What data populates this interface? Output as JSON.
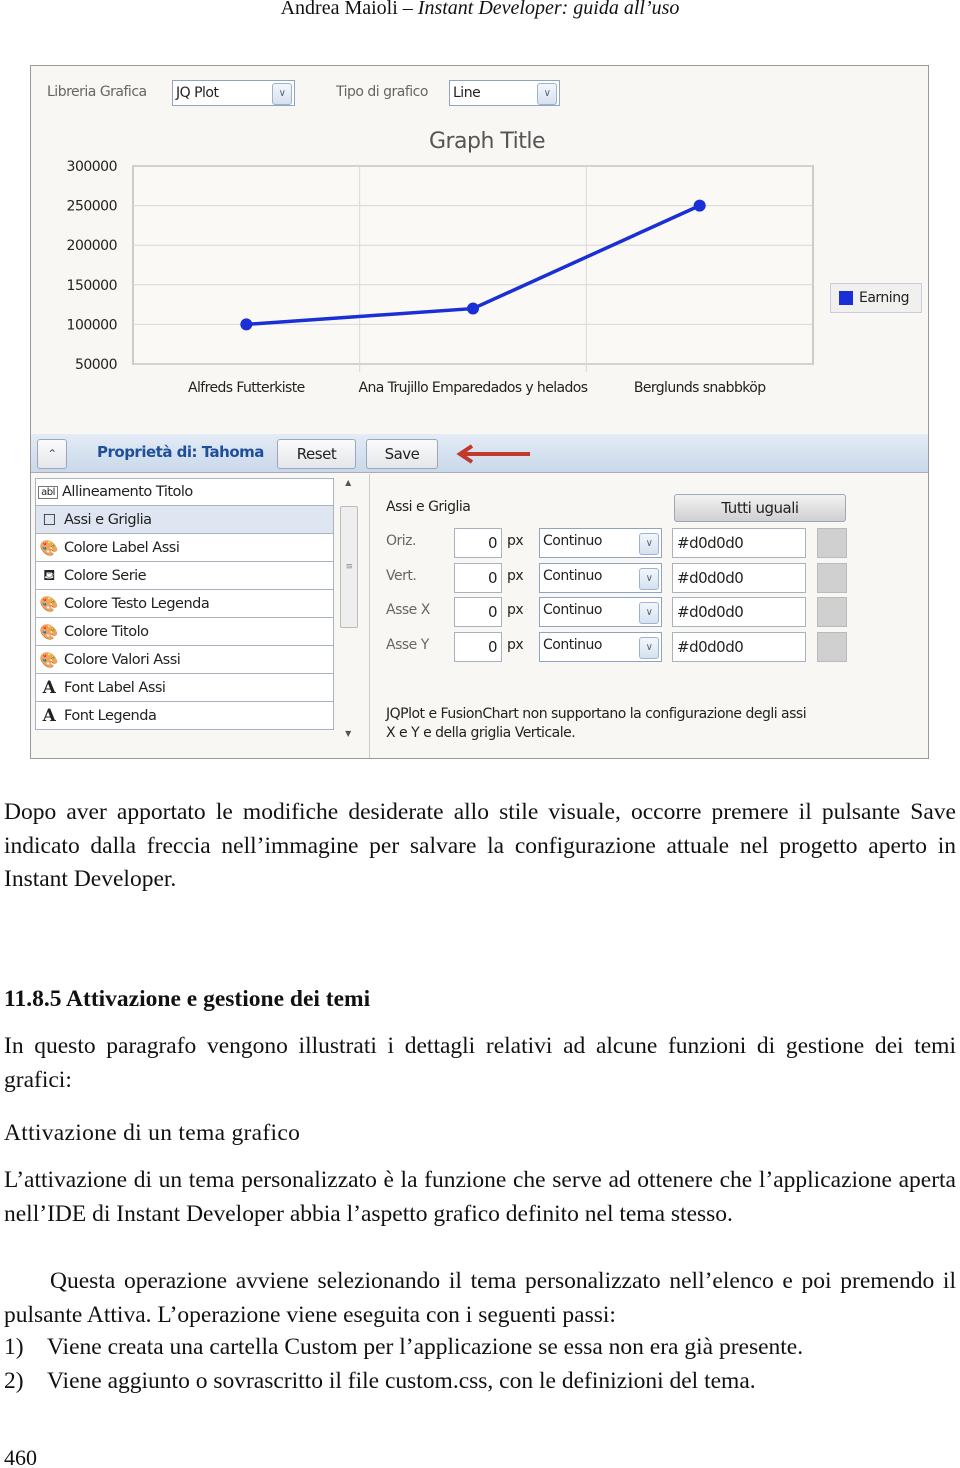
{
  "header": {
    "author": "Andrea Maioli",
    "separator": "–",
    "book": "Instant Developer: guida all’uso"
  },
  "screenshot": {
    "library_label": "Libreria Grafica",
    "library_value": "JQ Plot",
    "type_label": "Tipo di grafico",
    "type_value": "Line",
    "chart_data": {
      "type": "line",
      "title": "Graph Title",
      "categories": [
        "Alfreds Futterkiste",
        "Ana Trujillo Emparedados y helados",
        "Berglunds snabbköp"
      ],
      "series": [
        {
          "name": "Earning",
          "values": [
            100000,
            120000,
            250000
          ],
          "color": "#1a2fd6"
        }
      ],
      "yticks": [
        "300000",
        "250000",
        "200000",
        "150000",
        "100000",
        "50000"
      ],
      "ylim": [
        50000,
        300000
      ],
      "grid": true,
      "legend": "right"
    },
    "toolbar": {
      "title": "Proprietà di: Tahoma",
      "reset": "Reset",
      "save": "Save",
      "arrow_color": "#c0392b"
    },
    "list": [
      {
        "icon": "abl-text-icon",
        "glyph": "abl",
        "label": "Allineamento Titolo"
      },
      {
        "icon": "checkbox-icon",
        "glyph": "☐",
        "label": "Assi e Griglia",
        "selected": true
      },
      {
        "icon": "palette-icon",
        "glyph": "🎨",
        "label": "Colore Label Assi"
      },
      {
        "icon": "paint-bucket-icon",
        "glyph": "⛾",
        "label": "Colore Serie"
      },
      {
        "icon": "palette-icon",
        "glyph": "🎨",
        "label": "Colore Testo Legenda"
      },
      {
        "icon": "palette-icon",
        "glyph": "🎨",
        "label": "Colore Titolo"
      },
      {
        "icon": "palette-icon",
        "glyph": "🎨",
        "label": "Colore Valori Assi"
      },
      {
        "icon": "font-icon",
        "glyph": "A",
        "label": "Font Label Assi"
      },
      {
        "icon": "font-icon",
        "glyph": "A",
        "label": "Font Legenda"
      }
    ],
    "panel": {
      "title": "Assi e Griglia",
      "all_same": "Tutti uguali",
      "rows": [
        {
          "label": "Oriz.",
          "width": "0",
          "unit": "px",
          "style": "Continuo",
          "color": "#d0d0d0"
        },
        {
          "label": "Vert.",
          "width": "0",
          "unit": "px",
          "style": "Continuo",
          "color": "#d0d0d0"
        },
        {
          "label": "Asse X",
          "width": "0",
          "unit": "px",
          "style": "Continuo",
          "color": "#d0d0d0"
        },
        {
          "label": "Asse Y",
          "width": "0",
          "unit": "px",
          "style": "Continuo",
          "color": "#d0d0d0"
        }
      ],
      "note1": "JQPlot e FusionChart non supportano la configurazione degli assi",
      "note2": "X e Y e della griglia Verticale."
    }
  },
  "text": {
    "p1": "Dopo aver apportato le modifiche desiderate allo stile visuale, occorre premere il pulsante Save indicato dalla freccia nell’immagine per salvare la configurazione attuale nel progetto aperto in Instant Developer.",
    "heading": "11.8.5 Attivazione e gestione dei temi",
    "p2": "In questo paragrafo vengono illustrati i dettagli relativi ad alcune funzioni di gestione dei temi grafici:",
    "subheading": "Attivazione di un tema grafico",
    "p3": "L’attivazione di un tema personalizzato è la funzione che serve ad ottenere che l’applicazione aperta nell’IDE di Instant Developer abbia l’aspetto grafico definito nel tema stesso.",
    "p4": "Questa operazione avviene selezionando il tema personalizzato nell’elenco e poi premendo il pulsante Attiva. L’operazione viene eseguita con i seguenti passi:",
    "steps": [
      {
        "n": "1)",
        "text": "Viene creata una cartella Custom per l’applicazione se essa non era già presente."
      },
      {
        "n": "2)",
        "text": "Viene aggiunto o sovrascritto il file custom.css, con le definizioni del tema."
      }
    ],
    "page_number": "460"
  }
}
